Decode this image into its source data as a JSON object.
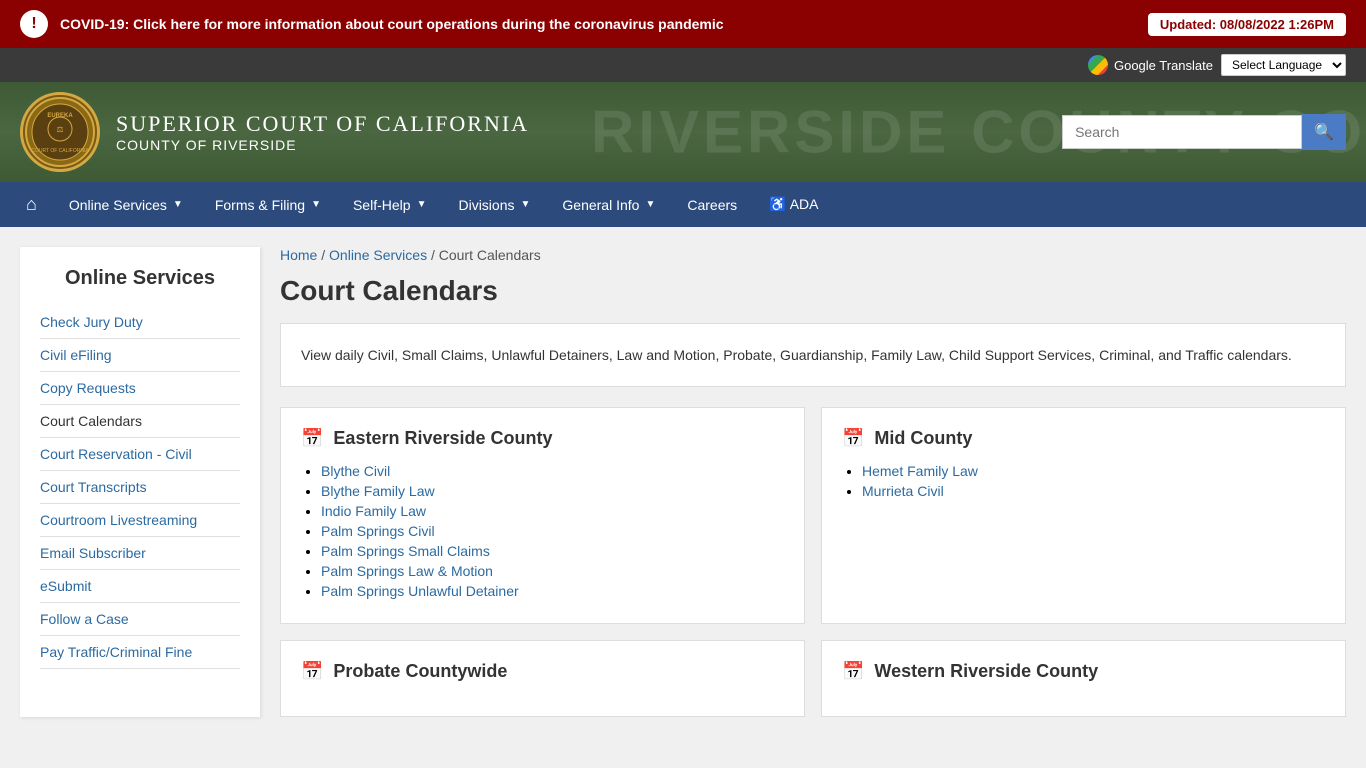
{
  "covid": {
    "banner_text": "COVID-19: Click here for more information about court operations during the coronavirus pandemic",
    "updated_text": "Updated: 08/08/2022 1:26PM",
    "icon": "!"
  },
  "header": {
    "court_name_main": "Superior Court of California",
    "court_name_sub": "County of Riverside",
    "bg_text": "RIVERSIDE COUNTY CO",
    "search_placeholder": "Search",
    "search_btn_label": "🔍"
  },
  "language": {
    "label": "Google Translate",
    "select_label": "Select Language"
  },
  "nav": {
    "home_icon": "⌂",
    "items": [
      {
        "label": "Online Services",
        "has_dropdown": true
      },
      {
        "label": "Forms & Filing",
        "has_dropdown": true
      },
      {
        "label": "Self-Help",
        "has_dropdown": true
      },
      {
        "label": "Divisions",
        "has_dropdown": true
      },
      {
        "label": "General Info",
        "has_dropdown": true
      },
      {
        "label": "Careers",
        "has_dropdown": false
      },
      {
        "label": "♿ ADA",
        "has_dropdown": false
      }
    ]
  },
  "sidebar": {
    "title": "Online Services",
    "links": [
      {
        "label": "Check Jury Duty",
        "active": false
      },
      {
        "label": "Civil eFiling",
        "active": false
      },
      {
        "label": "Copy Requests",
        "active": false
      },
      {
        "label": "Court Calendars",
        "active": true
      },
      {
        "label": "Court Reservation - Civil",
        "active": false
      },
      {
        "label": "Court Transcripts",
        "active": false
      },
      {
        "label": "Courtroom Livestreaming",
        "active": false
      },
      {
        "label": "Email Subscriber",
        "active": false
      },
      {
        "label": "eSubmit",
        "active": false
      },
      {
        "label": "Follow a Case",
        "active": false
      },
      {
        "label": "Pay Traffic/Criminal Fine",
        "active": false
      }
    ]
  },
  "breadcrumb": {
    "home": "Home",
    "online_services": "Online Services",
    "current": "Court Calendars"
  },
  "page_title": "Court Calendars",
  "description": "View daily Civil, Small Claims, Unlawful Detainers, Law and Motion, Probate, Guardianship, Family Law, Child Support Services, Criminal, and Traffic calendars.",
  "calendars": {
    "eastern": {
      "title": "Eastern Riverside County",
      "links": [
        "Blythe Civil",
        "Blythe Family Law",
        "Indio Family Law",
        "Palm Springs Civil",
        "Palm Springs Small Claims",
        "Palm Springs Law & Motion",
        "Palm Springs Unlawful Detainer"
      ]
    },
    "mid": {
      "title": "Mid County",
      "links": [
        "Hemet Family Law",
        "Murrieta Civil"
      ]
    },
    "probate": {
      "title": "Probate Countywide"
    },
    "western": {
      "title": "Western Riverside County"
    }
  }
}
